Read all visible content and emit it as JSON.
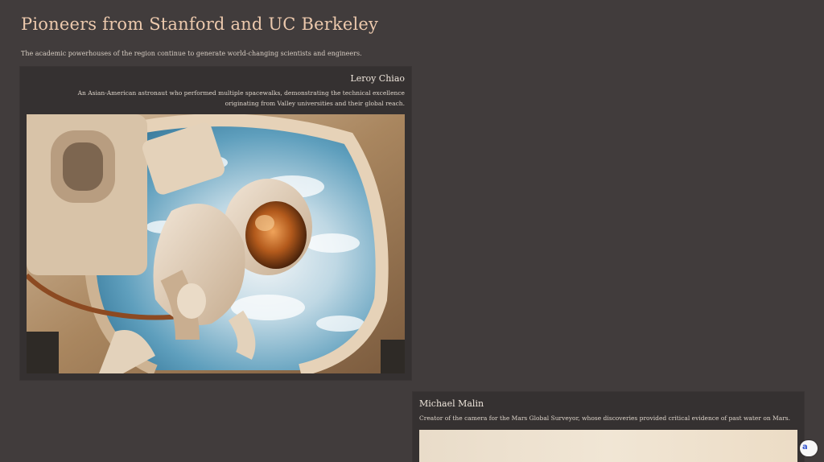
{
  "page": {
    "title": "Pioneers from Stanford and UC Berkeley",
    "subtitle": "The academic powerhouses of the region continue to generate world-changing scientists and engineers."
  },
  "cards": [
    {
      "name": "Leroy Chiao",
      "description": "An Asian-American astronaut who performed multiple spacewalks, demonstrating the technical excellence originating from Valley universities and their global reach.",
      "image_icon": "astronaut-spacewalk-image"
    },
    {
      "name": "Michael Malin",
      "description": "Creator of the camera for the Mars Global Surveyor, whose discoveries provided critical evidence of past water on Mars.",
      "image_icon": "mars-landscape-image"
    }
  ],
  "widget": {
    "glyph": "a",
    "icon": "assistant-bubble-icon"
  },
  "colors": {
    "background": "#413c3c",
    "card": "#353131",
    "title": "#ecc9ad",
    "widget_accent": "#3a5bd0"
  }
}
